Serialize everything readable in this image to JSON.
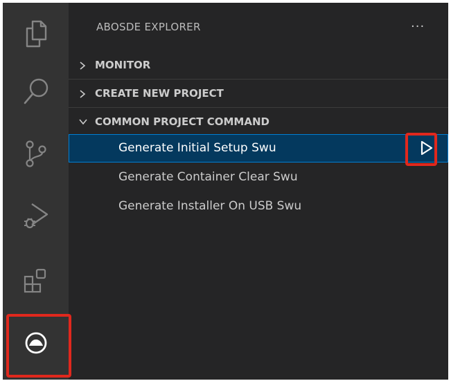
{
  "activity_bar": {
    "items": [
      {
        "name": "explorer",
        "icon": "files-icon"
      },
      {
        "name": "search",
        "icon": "search-icon"
      },
      {
        "name": "source-control",
        "icon": "source-control-icon"
      },
      {
        "name": "run-debug",
        "icon": "run-debug-icon"
      },
      {
        "name": "extensions",
        "icon": "extensions-icon"
      },
      {
        "name": "abosde",
        "icon": "abosde-icon",
        "highlighted": true
      }
    ]
  },
  "sidebar": {
    "title": "ABOSDE EXPLORER",
    "more_label": "···",
    "sections": [
      {
        "label": "MONITOR",
        "expanded": false
      },
      {
        "label": "CREATE NEW PROJECT",
        "expanded": false
      },
      {
        "label": "COMMON PROJECT COMMAND",
        "expanded": true
      }
    ],
    "items": [
      {
        "label": "Generate Initial Setup Swu",
        "selected": true,
        "action_icon": "play-icon"
      },
      {
        "label": "Generate Container Clear Swu",
        "selected": false
      },
      {
        "label": "Generate Installer On USB Swu",
        "selected": false
      }
    ]
  },
  "colors": {
    "activity_bar_bg": "#333333",
    "sidebar_bg": "#252526",
    "selection_bg": "#04395e",
    "selection_border": "#007fd4",
    "highlight": "#e0281d"
  }
}
